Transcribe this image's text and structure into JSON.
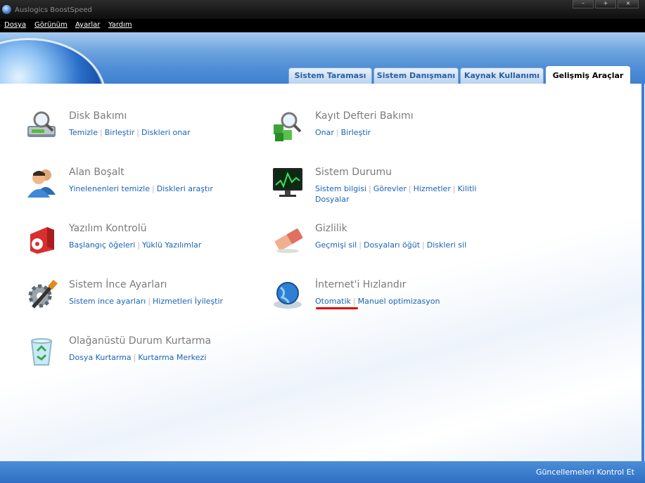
{
  "window": {
    "title": "Auslogics BoostSpeed",
    "buttons": [
      "–",
      "+",
      "×"
    ]
  },
  "menu": [
    "Dosya",
    "Görünüm",
    "Ayarlar",
    "Yardım"
  ],
  "tabs": [
    {
      "label": "Sistem Taraması",
      "active": false
    },
    {
      "label": "Sistem Danışmanı",
      "active": false
    },
    {
      "label": "Kaynak Kullanımı",
      "active": false
    },
    {
      "label": "Gelişmiş Araçlar",
      "active": true
    }
  ],
  "tools": [
    {
      "title": "Disk Bakımı",
      "icon": "disk-magnifier-icon",
      "links": [
        "Temizle",
        "Birleştir",
        "Diskleri onar"
      ]
    },
    {
      "title": "Kayıt Defteri Bakımı",
      "icon": "registry-cubes-icon",
      "links": [
        "Onar",
        "Birleştir"
      ]
    },
    {
      "title": "Alan Boşalt",
      "icon": "users-icon",
      "links": [
        "Yinelenenleri temizle",
        "Diskleri araştır"
      ]
    },
    {
      "title": "Sistem Durumu",
      "icon": "monitor-chart-icon",
      "links": [
        "Sistem bilgisi",
        "Görevler",
        "Hizmetler",
        "Kilitli Dosyalar"
      ]
    },
    {
      "title": "Yazılım Kontrolü",
      "icon": "software-box-icon",
      "links": [
        "Başlangıç öğeleri",
        "Yüklü Yazılımlar"
      ]
    },
    {
      "title": "Gizlilik",
      "icon": "eraser-icon",
      "links": [
        "Geçmişi sil",
        "Dosyaları öğüt",
        "Diskleri sil"
      ]
    },
    {
      "title": "Sistem İnce Ayarları",
      "icon": "gear-wrench-icon",
      "links": [
        "Sistem ince ayarları",
        "Hizmetleri İyileştir"
      ]
    },
    {
      "title": "İnternet'i Hızlandır",
      "icon": "globe-magnifier-icon",
      "links": [
        "Otomatik",
        "Manuel optimizasyon"
      ]
    },
    {
      "title": "Olağanüstü Durum Kurtarma",
      "icon": "recycle-bin-icon",
      "links": [
        "Dosya Kurtarma",
        "Kurtarma Merkezi"
      ]
    }
  ],
  "footer": {
    "update_label": "Güncellemeleri Kontrol Et"
  },
  "colors": {
    "accent": "#3f80d0",
    "link": "#1a63b5",
    "highlight": "#e00000"
  }
}
